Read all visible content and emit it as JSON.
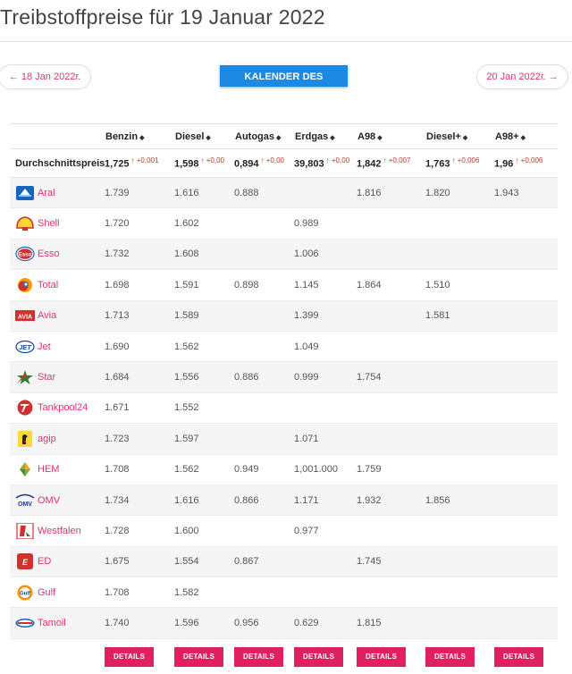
{
  "header": {
    "title": "Treibstoffpreise für 19 Januar 2022"
  },
  "nav": {
    "prev_label": "← 18 Jan 2022г.",
    "next_label": "20 Jan 2022г. →",
    "calendar_label": "KALENDER DES MONATS"
  },
  "table": {
    "columns": [
      "Benzin",
      "Diesel",
      "Autogas",
      "Erdgas",
      "A98",
      "Diesel+",
      "A98+"
    ],
    "average": {
      "label": "Durchschnittspreis",
      "values": [
        "1,725",
        "1,598",
        "0,894",
        "39,803",
        "1,842",
        "1,763",
        "1,96"
      ],
      "changes": [
        "↑ +0,001",
        "↑ +0,00",
        "↑ +0,00",
        "↑ +0,00",
        "↑ +0,007",
        "↑ +0,006",
        "↑ +0,006"
      ]
    },
    "rows": [
      {
        "brand": "Aral",
        "logo": "aral-logo",
        "values": [
          "1.739",
          "1.616",
          "0.888",
          "",
          "1.816",
          "1.820",
          "1.943"
        ]
      },
      {
        "brand": "Shell",
        "logo": "shell-logo",
        "values": [
          "1.720",
          "1.602",
          "",
          "0.989",
          "",
          "",
          ""
        ]
      },
      {
        "brand": "Esso",
        "logo": "esso-logo",
        "values": [
          "1.732",
          "1.608",
          "",
          "1.006",
          "",
          "",
          ""
        ]
      },
      {
        "brand": "Total",
        "logo": "total-logo",
        "values": [
          "1.698",
          "1.591",
          "0.898",
          "1.145",
          "1.864",
          "1.510",
          ""
        ]
      },
      {
        "brand": "Avia",
        "logo": "avia-logo",
        "values": [
          "1.713",
          "1.589",
          "",
          "1.399",
          "",
          "1.581",
          ""
        ]
      },
      {
        "brand": "Jet",
        "logo": "jet-logo",
        "values": [
          "1.690",
          "1.562",
          "",
          "1.049",
          "",
          "",
          ""
        ]
      },
      {
        "brand": "Star",
        "logo": "star-logo",
        "values": [
          "1.684",
          "1.556",
          "0.886",
          "0.999",
          "1.754",
          "",
          ""
        ]
      },
      {
        "brand": "Tankpool24",
        "logo": "tankpool24-logo",
        "values": [
          "1.671",
          "1.552",
          "",
          "",
          "",
          "",
          ""
        ]
      },
      {
        "brand": "agip",
        "logo": "agip-logo",
        "values": [
          "1.723",
          "1.597",
          "",
          "1.071",
          "",
          "",
          ""
        ]
      },
      {
        "brand": "HEM",
        "logo": "hem-logo",
        "values": [
          "1.708",
          "1.562",
          "0.949",
          "1,001.000",
          "1.759",
          "",
          ""
        ]
      },
      {
        "brand": "OMV",
        "logo": "omv-logo",
        "values": [
          "1.734",
          "1.616",
          "0.866",
          "1.171",
          "1.932",
          "1.856",
          ""
        ]
      },
      {
        "brand": "Westfalen",
        "logo": "westfalen-logo",
        "values": [
          "1.728",
          "1.600",
          "",
          "0.977",
          "",
          "",
          ""
        ]
      },
      {
        "brand": "ED",
        "logo": "ed-logo",
        "values": [
          "1.675",
          "1.554",
          "0.867",
          "",
          "1.745",
          "",
          ""
        ]
      },
      {
        "brand": "Gulf",
        "logo": "gulf-logo",
        "values": [
          "1.708",
          "1.582",
          "",
          "",
          "",
          "",
          ""
        ]
      },
      {
        "brand": "Tamoil",
        "logo": "tamoil-logo",
        "values": [
          "1.740",
          "1.596",
          "0.956",
          "0.629",
          "1.815",
          "",
          ""
        ]
      }
    ],
    "details_label": "DETAILS",
    "sort_icon": "sort-icon",
    "trend_icon": "arrow-up-icon"
  },
  "colors": {
    "accent": "#e0356b",
    "button_blue": "#1e88e5",
    "details_button": "#e0205f",
    "trend_up": "#c0392b"
  }
}
